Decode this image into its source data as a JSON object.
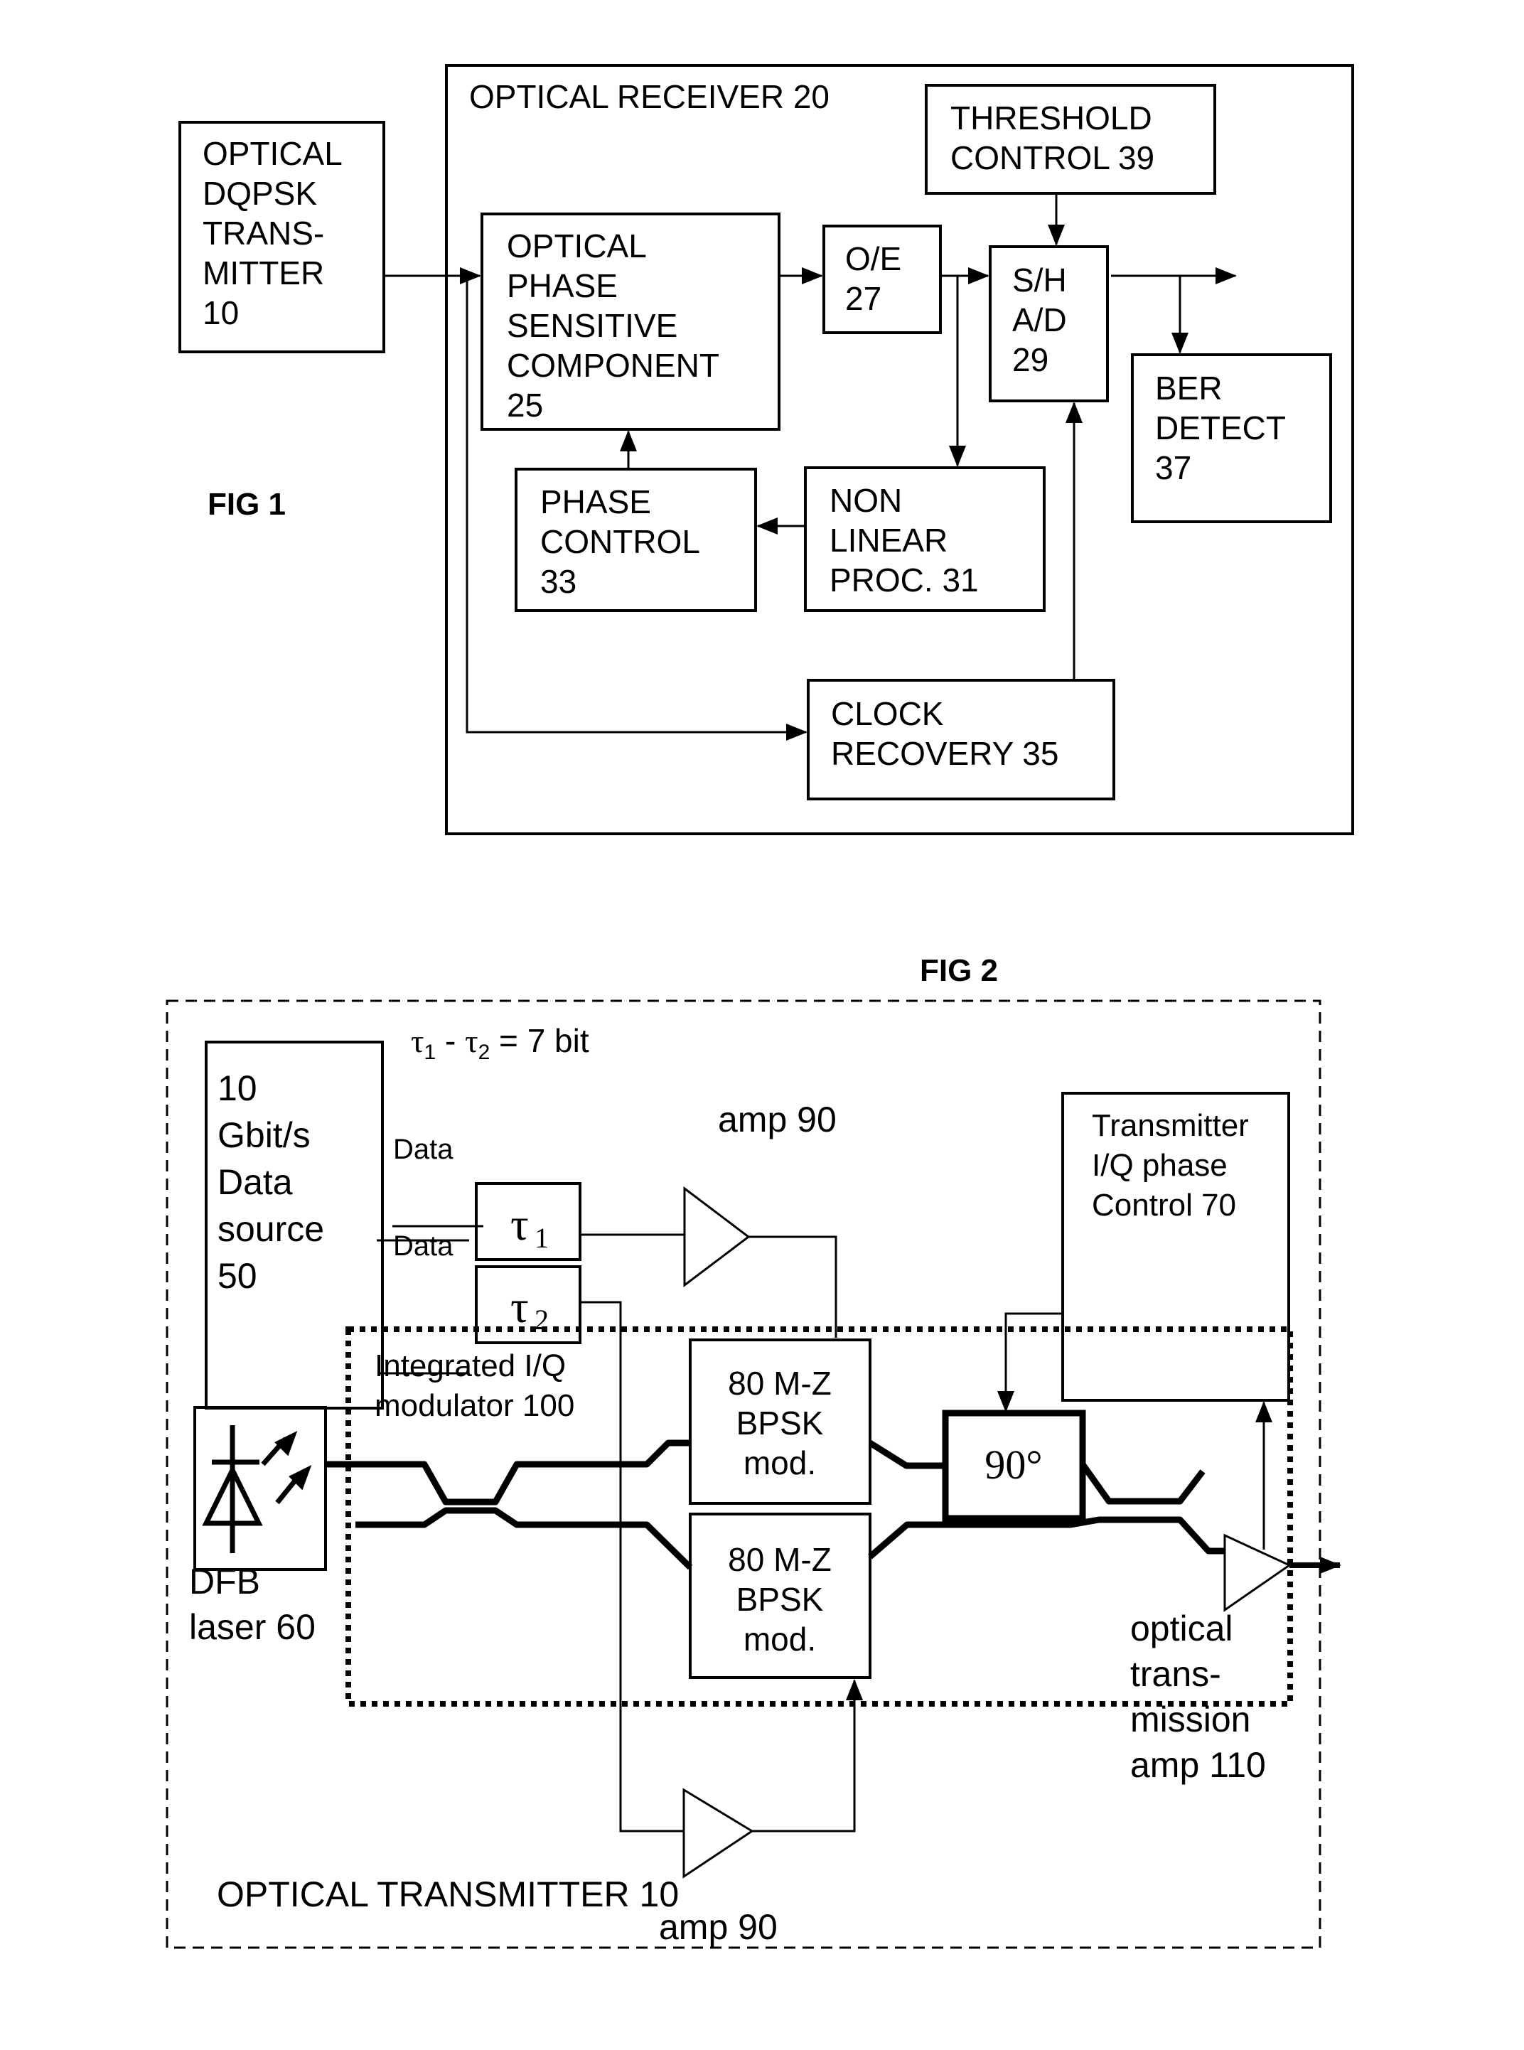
{
  "fig1": {
    "label": "FIG 1",
    "receiver_title": "OPTICAL RECEIVER 20",
    "transmitter": [
      "OPTICAL",
      "DQPSK",
      "TRANS-",
      "MITTER",
      "10"
    ],
    "phase_sensitive": [
      "OPTICAL",
      "PHASE",
      "SENSITIVE",
      "COMPONENT",
      "25"
    ],
    "oe": [
      "O/E",
      "27"
    ],
    "sh_ad": [
      "S/H",
      "A/D",
      "29"
    ],
    "threshold": [
      "THRESHOLD",
      "CONTROL 39"
    ],
    "ber": [
      "BER",
      "DETECT",
      "37"
    ],
    "phase_control": [
      "PHASE",
      "CONTROL",
      "33"
    ],
    "nonlinear": [
      "NON",
      "LINEAR",
      "PROC. 31"
    ],
    "clock": [
      "CLOCK",
      "RECOVERY 35"
    ]
  },
  "fig2": {
    "label": "FIG 2",
    "tau_eq": {
      "t1": "τ",
      "s1": "1",
      "minus": " - ",
      "t2": "τ",
      "s2": "2",
      "rest": " = 7 bit"
    },
    "data_source": [
      "10",
      "Gbit/s",
      "Data",
      "source",
      "50"
    ],
    "data_label": "Data",
    "data_bar_label": "Data",
    "tau1": {
      "sym": "τ",
      "sub": "1"
    },
    "tau2": {
      "sym": "τ",
      "sub": "2"
    },
    "amp_top": "amp 90",
    "amp_bottom": "amp 90",
    "iq_control": [
      "Transmitter",
      "I/Q phase",
      "Control 70"
    ],
    "integrated": [
      "Integrated I/Q",
      "modulator 100"
    ],
    "mz_top": [
      "80 M-Z",
      "BPSK",
      "mod."
    ],
    "mz_bottom": [
      "80 M-Z",
      "BPSK",
      "mod."
    ],
    "phase90": "90°",
    "dfb": [
      "DFB",
      "laser 60"
    ],
    "opt_amp": [
      "optical",
      "trans-",
      "mission",
      "amp 110"
    ],
    "transmitter_title": "OPTICAL TRANSMITTER 10"
  }
}
